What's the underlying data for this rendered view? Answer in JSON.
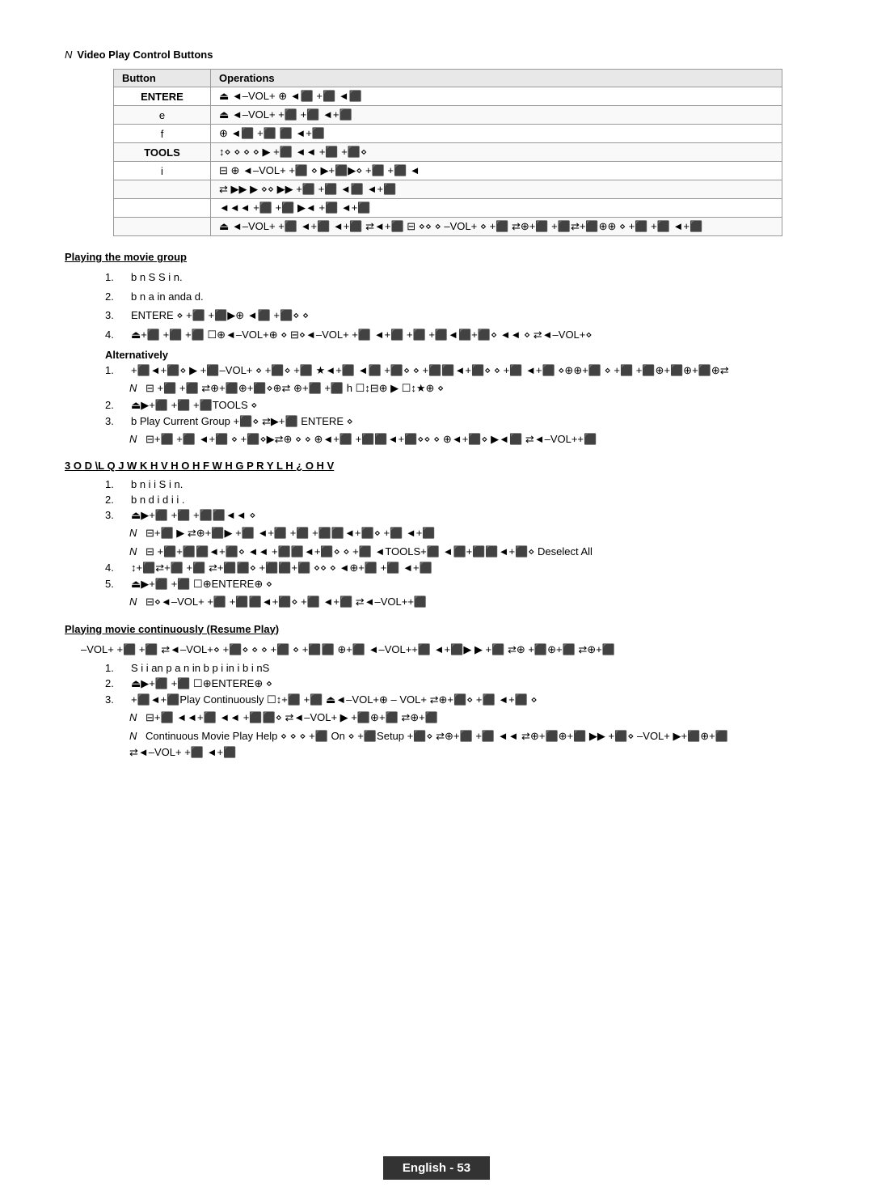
{
  "page": {
    "n_label": "N",
    "section1_title": "Video Play Control Buttons",
    "table": {
      "headers": [
        "Button",
        "Operations"
      ],
      "rows": [
        {
          "button": "ENTERE",
          "ops": "⏏ ◄–VOL+ ⊕ ◄⬛ +⬛ ◄⬛",
          "bold": true
        },
        {
          "button": "e",
          "ops": "⏏ ◄–VOL+ +⬛ +⬛ ◄+⬛",
          "bold": false
        },
        {
          "button": "f",
          "ops": "⊕ ◄⬛ +⬛ ⬛ ◄+⬛",
          "bold": false
        },
        {
          "button": "TOOLS",
          "ops": "↕⋄ ⋄ ⋄ ⋄ ▶ +⬛ ◄◄ +⬛ +⬛⋄",
          "bold": true
        },
        {
          "button": "i",
          "ops": "⊟ ⊕ ◄–VOL+ +⬛ ⋄ ▶+⬛▶⋄ +⬛ +⬛ ◄",
          "bold": false
        },
        {
          "button": "",
          "ops": "⇄ ▶▶ ▶ ⋄⋄ ▶▶ +⬛ +⬛ ◄⬛ ◄+⬛",
          "bold": false
        },
        {
          "button": "",
          "ops": "◄◄◄ +⬛ +⬛ ▶◄ +⬛ ◄+⬛",
          "bold": false
        },
        {
          "button": "",
          "ops": "⏏ ◄–VOL+ +⬛ ◄+⬛ ◄+⬛ ⇄◄+⬛ ⊟ ⋄⋄ ⋄ –VOL+ ⋄ +⬛ ⇄⊕+⬛ +⬛⇄+⬛⊕⊕ ⋄ +⬛ +⬛ ◄+⬛",
          "bold": false
        }
      ]
    },
    "section2_title": "Playing the movie group",
    "playing_group_items": [
      {
        "num": "1.",
        "text": "b              n                    S         S     i  n."
      },
      {
        "num": "2.",
        "text": "b              n               a       in     anda  d."
      },
      {
        "num": "3.",
        "text": "ENTERE   ⋄  +⬛  +⬛▶⊕  ◄⬛  +⬛⋄ ⋄"
      },
      {
        "num": "4.",
        "text": "⏏+⬛ +⬛ +⬛  ☐⊕◄–VOL+⊕ ⋄ ⊟⋄◄–VOL+ +⬛ ◄+⬛ +⬛ +⬛◄⬛+⬛⋄ ◄◄ ⋄ ⇄◄–VOL+⋄"
      }
    ],
    "alt_label": "Alternatively",
    "alt_items": [
      {
        "num": "1.",
        "text": "+⬛◄+⬛⋄ ▶ +⬛–VOL+ ⋄ +⬛⋄ +⬛ ★◄+⬛ ◄⬛ +⬛⋄ ⋄ +⬛⬛◄+⬛⋄ ⋄ +⬛ ◄+⬛ ⋄⊕⊕+⬛ ⋄ +⬛ +⬛⊕+⬛⊕+⬛⊕⇄"
      },
      {
        "num": "",
        "note": true,
        "n": "N",
        "text": "⊟ +⬛ +⬛ ⇄⊕+⬛⊕+⬛⋄⊕⇄ ⊕+⬛ +⬛  h   ☐↕⊟⊕ ▶ ☐↕★⊕ ⋄"
      },
      {
        "num": "2.",
        "text": "⏏▶+⬛ +⬛ +⬛TOOLS ⋄"
      },
      {
        "num": "3.",
        "text": "                   b   Play Current Group +⬛⋄  ⇄▶+⬛ ENTERE   ⋄"
      },
      {
        "num": "",
        "note": true,
        "n": "N",
        "text": "⊟+⬛ +⬛ ◄+⬛ ⋄ +⬛⋄▶⇄⊕ ⋄ ⋄ ⊕◄+⬛ +⬛⬛◄+⬛⋄⋄ ⋄ ⊕◄+⬛⋄ ▶◄⬛ ⇄◄–VOL++⬛"
      }
    ],
    "section3_title": "3 O D \\L Q J  W K H  V H O H F W H G  P R Y L H  ¿ O H V",
    "selected_items": [
      {
        "num": "1.",
        "text": "b              n                   i      i    S     i  n."
      },
      {
        "num": "2.",
        "text": "b              n              d     i    d    i    i   ."
      },
      {
        "num": "3.",
        "text": "⏏▶+⬛ +⬛ +⬛⬛◄◄ ⋄"
      },
      {
        "num": "",
        "note": true,
        "n": "N",
        "text": "⊟+⬛  ▶ ⇄⊕+⬛▶ +⬛ ◄+⬛ +⬛ +⬛⬛◄+⬛⋄ +⬛ ◄+⬛"
      },
      {
        "num": "",
        "note": true,
        "n": "N",
        "text": "⊟ +⬛+⬛⬛◄+⬛⋄ ◄◄ +⬛⬛◄+⬛⋄ ⋄ +⬛ ◄TOOLS+⬛ ◄⬛+⬛⬛◄+⬛⋄ Deselect All"
      },
      {
        "num": "4.",
        "text": "↕+⬛⇄+⬛ +⬛ ⇄+⬛⬛⋄ +⬛⬛+⬛ ⋄⋄ ⋄ ◄⊕+⬛ +⬛ ◄+⬛"
      },
      {
        "num": "5.",
        "text": "⏏▶+⬛ +⬛  ☐⊕ENTERE⊕ ⋄"
      },
      {
        "num": "",
        "note": true,
        "n": "N",
        "text": "⊟⋄◄–VOL+ +⬛ +⬛⬛◄+⬛⋄ +⬛ ◄+⬛ ⇄◄–VOL++⬛"
      }
    ],
    "section4_title": "Playing movie continuously (Resume Play)",
    "resume_intro": "–VOL+ +⬛ +⬛ ⇄◄–VOL+⋄ +⬛⋄ ⋄ ⋄ +⬛ ⋄ +⬛⬛ ⊕+⬛ ◄–VOL++⬛ ◄+⬛▶ ▶ +⬛ ⇄⊕ +⬛⊕+⬛  ⇄⊕+⬛",
    "resume_items": [
      {
        "num": "1.",
        "text": "S            i    i          an    p  a   n  in           b  p    i  in                    i  b    i   nS"
      },
      {
        "num": "2.",
        "text": "⏏▶+⬛ +⬛  ☐⊕ENTERE⊕ ⋄"
      },
      {
        "num": "3.",
        "text": "+⬛◄+⬛Play Continuously ☐↕+⬛ +⬛  ⏏◄–VOL+⊕ – VOL+ ⇄⊕+⬛⋄ +⬛ ◄+⬛ ⋄"
      },
      {
        "num": "",
        "note": true,
        "n": "N",
        "text": "⊟+⬛ ◄◄+⬛ ◄◄ +⬛⬛⋄  ⇄◄–VOL+ ▶ +⬛⊕+⬛  ⇄⊕+⬛"
      },
      {
        "num": "",
        "note": true,
        "n": "N",
        "text": "Continuous Movie Play Help ⋄ ⋄ ⋄ +⬛  On ⋄ +⬛Setup +⬛⋄  ⇄⊕+⬛ +⬛ ◄◄ ⇄⊕+⬛⊕+⬛ ▶▶ +⬛⋄ –VOL+ ▶+⬛⊕+⬛"
      },
      {
        "num": "",
        "note": false,
        "n": "",
        "text": "⇄◄–VOL+ +⬛ ◄+⬛"
      }
    ],
    "footer": {
      "text": "English - 53"
    }
  }
}
